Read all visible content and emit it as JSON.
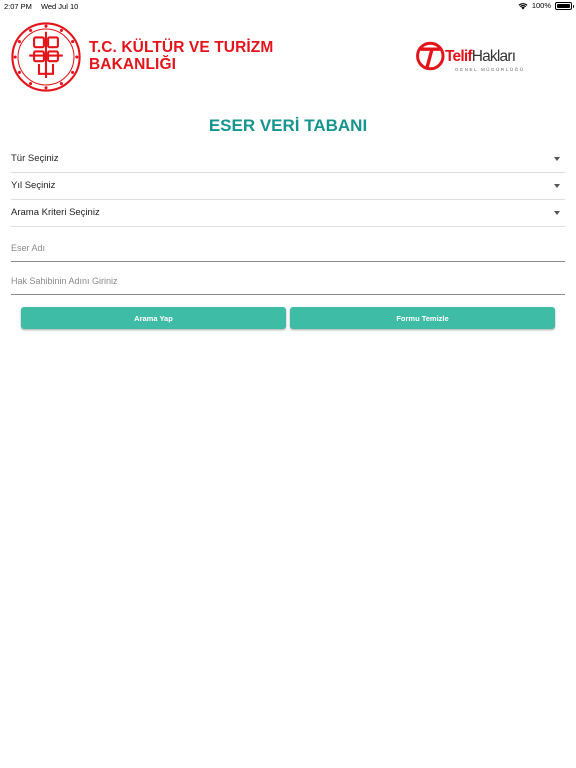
{
  "status_bar": {
    "time": "2:07 PM",
    "date": "Wed Jul 10",
    "battery": "100%"
  },
  "header": {
    "ministry_line1": "T.C. KÜLTÜR VE TURİZM",
    "ministry_line2": "BAKANLIĞI",
    "telif_bold": "Telif",
    "telif_thin": "Hakları",
    "telif_sub": "GENEL MÜDÜRLÜĞÜ"
  },
  "title": "ESER VERİ TABANI",
  "selects": {
    "tur": "Tür Seçiniz",
    "yil": "Yıl Seçiniz",
    "kriter": "Arama Kriteri Seçiniz"
  },
  "inputs": {
    "eser_placeholder": "Eser Adı",
    "hak_placeholder": "Hak Sahibinin Adını Giriniz"
  },
  "buttons": {
    "search": "Arama Yap",
    "clear": "Formu Temizle"
  },
  "colors": {
    "brand_red": "#e3141b",
    "title_teal": "#16958f",
    "button_teal": "#3fbca6"
  },
  "icons": [
    "wifi-icon",
    "battery-icon",
    "caret-down-icon"
  ]
}
